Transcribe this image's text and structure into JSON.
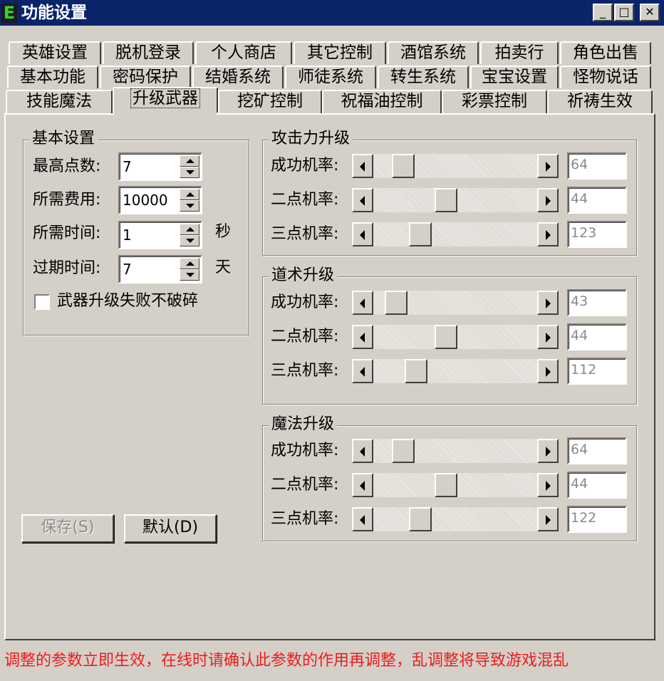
{
  "window": {
    "icon_letter": "E",
    "title": "功能设置",
    "min_glyph": "_",
    "max_glyph": "□",
    "close_glyph": "✕"
  },
  "tabs": {
    "row1": [
      "英雄设置",
      "脱机登录",
      "个人商店",
      "其它控制",
      "酒馆系统",
      "拍卖行",
      "角色出售"
    ],
    "row2": [
      "基本功能",
      "密码保护",
      "结婚系统",
      "师徒系统",
      "转生系统",
      "宝宝设置",
      "怪物说话"
    ],
    "row3": [
      "技能魔法",
      "升级武器",
      "挖矿控制",
      "祝福油控制",
      "彩票控制",
      "祈祷生效"
    ],
    "active": "升级武器"
  },
  "basic": {
    "title": "基本设置",
    "max_points_label": "最高点数:",
    "max_points": "7",
    "fee_label": "所需费用:",
    "fee": "10000",
    "time_label": "所需时间:",
    "time": "1",
    "time_unit": "秒",
    "expire_label": "过期时间:",
    "expire": "7",
    "expire_unit": "天",
    "no_break_label": "武器升级失败不破碎",
    "no_break_checked": false
  },
  "attack": {
    "title": "攻击力升级",
    "rows": [
      {
        "label": "成功机率:",
        "value": "64"
      },
      {
        "label": "二点机率:",
        "value": "44"
      },
      {
        "label": "三点机率:",
        "value": "123"
      }
    ]
  },
  "taoism": {
    "title": "道术升级",
    "rows": [
      {
        "label": "成功机率:",
        "value": "43"
      },
      {
        "label": "二点机率:",
        "value": "44"
      },
      {
        "label": "三点机率:",
        "value": "112"
      }
    ]
  },
  "magic": {
    "title": "魔法升级",
    "rows": [
      {
        "label": "成功机率:",
        "value": "64"
      },
      {
        "label": "二点机率:",
        "value": "44"
      },
      {
        "label": "三点机率:",
        "value": "122"
      }
    ]
  },
  "buttons": {
    "save": "保存(S)",
    "default": "默认(D)"
  },
  "notice": "调整的参数立即生效，在线时请确认此参数的作用再调整，乱调整将导致游戏混乱",
  "colors": {
    "titlebar": "#0a246a",
    "face": "#d4d0c8",
    "notice": "#ee1c1c"
  }
}
